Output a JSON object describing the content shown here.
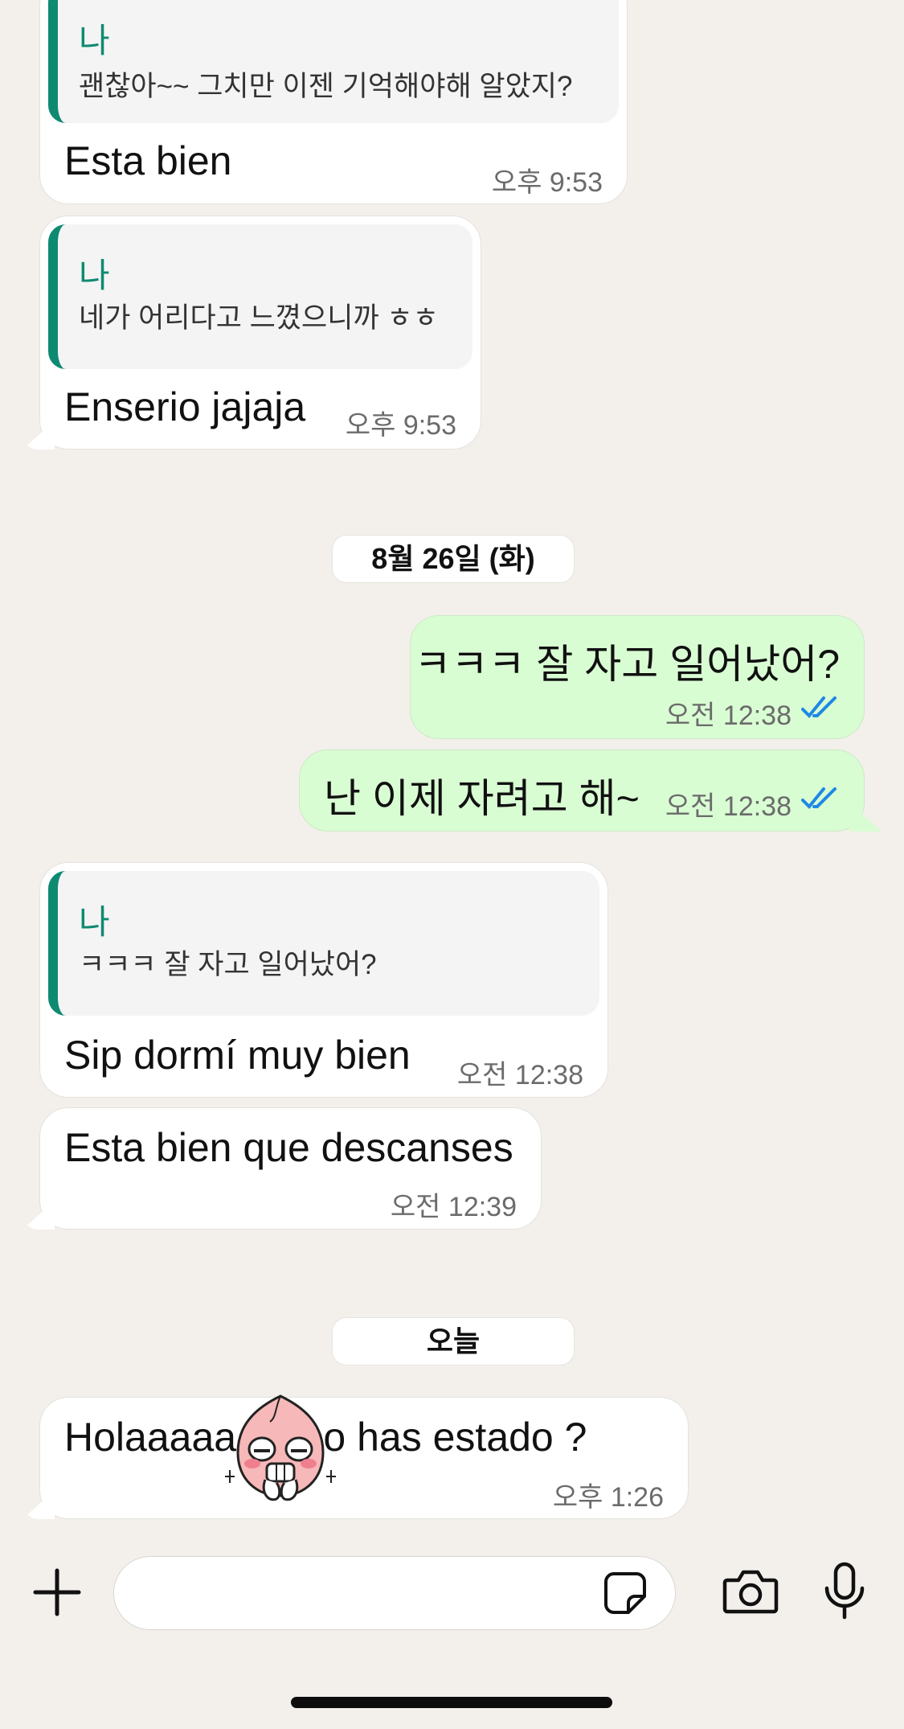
{
  "messages": {
    "m1": {
      "quote_name": "나",
      "quote_text": "괜찮아~~ 그치만 이젠 기억해야해 알았지?",
      "text": "Esta bien",
      "time": "오후 9:53"
    },
    "m2": {
      "quote_name": "나",
      "quote_text": "네가 어리다고 느꼈으니까 ㅎㅎ",
      "text": "Enserio jajaja",
      "time": "오후 9:53"
    },
    "date1": "8월 26일 (화)",
    "m3": {
      "text": "ㅋㅋㅋ 잘 자고 일어났어?",
      "time": "오전 12:38",
      "status": "read"
    },
    "m4": {
      "text": "난 이제 자려고 해~",
      "time": "오전 12:38",
      "status": "read"
    },
    "m5": {
      "quote_name": "나",
      "quote_text": "ㅋㅋㅋ 잘 자고 일어났어?",
      "text": "Sip dormí muy bien",
      "time": "오전 12:38"
    },
    "m6": {
      "text": "Esta bien que descanses",
      "time": "오전 12:39"
    },
    "date2": "오늘",
    "m7": {
      "text": "Holaaaaa como has estado ?",
      "time": "오후 1:26",
      "sticker": "peach-face-sticker"
    }
  },
  "input": {
    "placeholder": ""
  },
  "icons": [
    "plus-icon",
    "sticker-icon",
    "camera-icon",
    "mic-icon",
    "double-check-icon"
  ],
  "colors": {
    "background": "#f3f0eb",
    "outgoing": "#d9fdd3",
    "incoming": "#ffffff",
    "quote_accent": "#0f8a72",
    "read_ticks": "#1e88e5"
  }
}
